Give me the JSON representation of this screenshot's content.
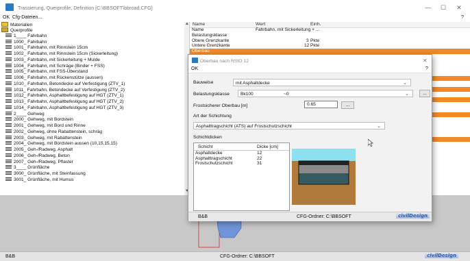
{
  "window": {
    "title": "Trassierung, Querprofile, Definition  [C:\\BBSOFT\\bbroad.CFG]",
    "minimize": "—",
    "maximize": "☐",
    "close": "✕"
  },
  "menu": {
    "ok": "OK",
    "cfg": "Cfg-Dateien...",
    "help": "?"
  },
  "tree": {
    "root_materials": "Materialien",
    "root_profiles": "Querprofile",
    "items": [
      "1____ Fahrbahn",
      "1000_ Fahrbahn",
      "1001_ Fahrbahn, mit Rinnstein 15cm",
      "1002_ Fahrbahn, mit Rinnstein 15cm (Sickerleitung)",
      "1003_ Fahrbahn, mit Sickerleitung + Mulde",
      "1004_ Fahrbahn, mit Schräge (Binder + FSS)",
      "1005_ Fahrbahn, mit FSS-Überstand",
      "1006_ Fahrbahn, mit Rückenstütze (aussen)",
      "1010_ Fahrbahn, Betondecke auf Verfestigung (ZTV_1)",
      "1011_ Fahrbahn, Betondecke auf Verfestigung (ZTV_2)",
      "1012_ Fahrbahn, Asphaltbefestigung auf HGT (ZTV_1)",
      "1013_ Fahrbahn, Asphaltbefestigung auf HGT (ZTV_2)",
      "1014_ Fahrbahn, Asphaltbefestigung auf HGT (ZTV_3)",
      "2____ Gehweg",
      "2000_ Gehweg, mit Bordstein",
      "2001_ Gehweg, mit Bord und Rinne",
      "2002_ Gehweg, ohne Rabattenstein, schräg",
      "2003_ Gehweg, mit Rabattenstein",
      "2004_ Gehweg, mit Bordstein aussen (10,15,15,15)",
      "2005_ Geh-/Radweg, Asphalt",
      "2006_ Geh-/Radweg, Beton",
      "2007_ Geh-/Radweg, Pflaster",
      "3____ Grünfläche",
      "3000_ Grünfläche, mit Steinfassung",
      "3001_ Grünfläche, mit Humus"
    ]
  },
  "props": {
    "headers": {
      "name": "Name",
      "wert": "Wert",
      "einh": "Einh."
    },
    "rows": [
      {
        "name": "Name",
        "wert": "Fahrbahn, mit Sickerleitung + ...",
        "einh": ""
      },
      {
        "name": "Belastungsklasse",
        "wert": "",
        "einh": ""
      },
      {
        "name": "Obere  Grenzkante",
        "wert": "3",
        "einh": "Pkte"
      },
      {
        "name": "Untere Grenzkante",
        "wert": "12",
        "einh": "Pkte"
      },
      {
        "name": "Oberbau",
        "wert": "",
        "einh": ""
      }
    ]
  },
  "dialog": {
    "title": "Oberbau nach RStO 12",
    "menu_ok": "OK",
    "menu_help": "?",
    "close": "✕",
    "bauweise_label": "Bauweise",
    "bauweise_value": "mit Asphaltdecke",
    "belastung_label": "Belastungsklasse",
    "belastung_value": "Bk100",
    "belastung_value2": "~0",
    "frost_label": "Frostsicherer Oberbau [m]",
    "frost_value": "0.65",
    "frost_btn": "...",
    "belastung_btn": "...",
    "schichtung_label": "Art der Schichtung",
    "schichtung_value": "Asphalttragschicht (ATS) auf Frostschutzschicht",
    "schichtdicken_label": "Schichtdicken",
    "layer_headers": {
      "schicht": "Schicht",
      "dicke": "Dicke [cm]"
    },
    "layers": [
      {
        "schicht": "Asphaltdecke",
        "dicke": "12"
      },
      {
        "schicht": "Asphalttragschicht",
        "dicke": "22"
      },
      {
        "schicht": "Frostschutzschicht",
        "dicke": "31"
      }
    ],
    "status_left": "B&B",
    "status_mid": "CFG-Ordner:  C:\\BBSOFT",
    "logo": "civilDesign"
  },
  "status": {
    "left": "B&B",
    "mid": "CFG-Ordner:  C:\\BBSOFT",
    "logo": "civilDesign"
  },
  "colors": {
    "highlight": "#f08a24",
    "preview_sky": "#8ee0ee",
    "preview_soil": "#b07a3a",
    "profile_fill": "#6f95d8",
    "profile_line": "#d23030"
  }
}
